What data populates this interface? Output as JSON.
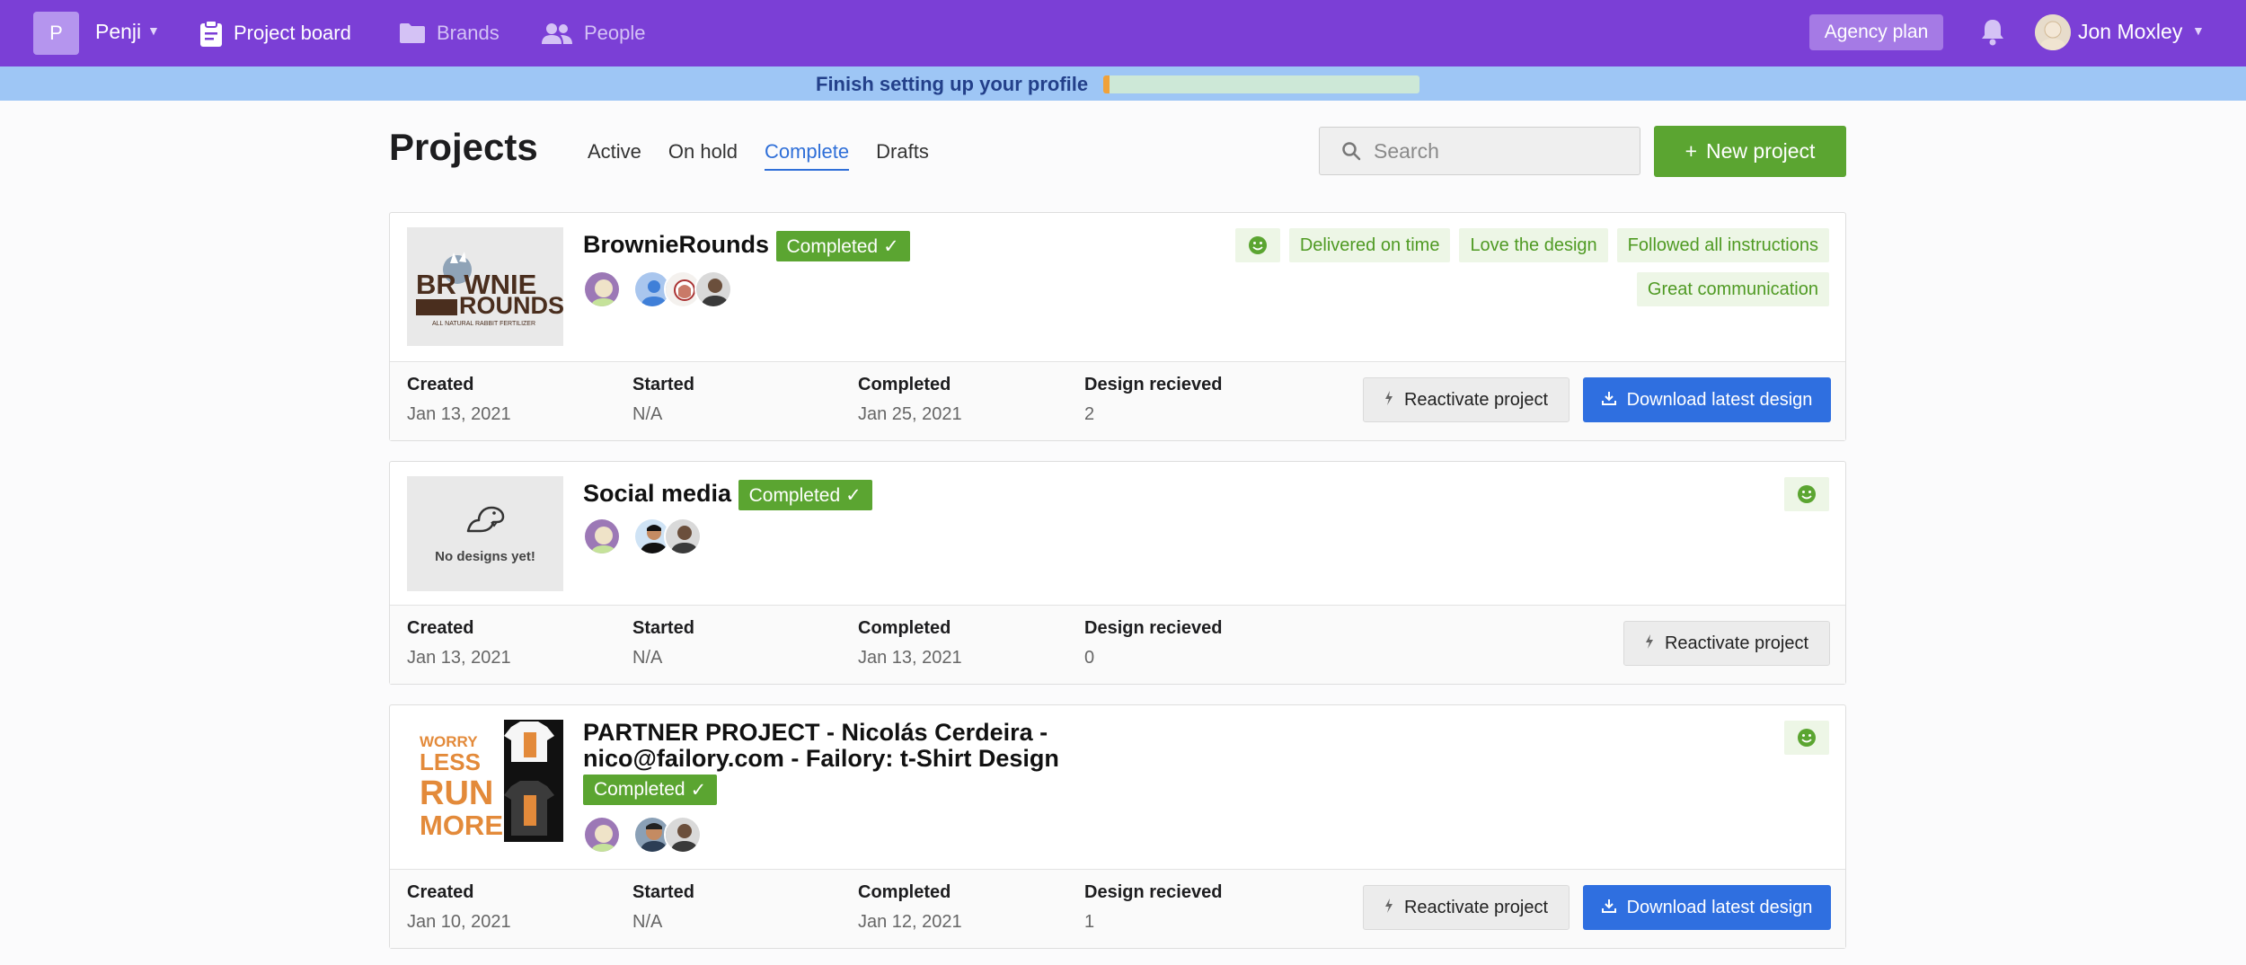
{
  "nav": {
    "workspace_initial": "P",
    "workspace_name": "Penji",
    "project_board": "Project board",
    "brands": "Brands",
    "people": "People",
    "plan": "Agency plan",
    "user_name": "Jon Moxley"
  },
  "banner": {
    "text": "Finish setting up your profile",
    "progress": 0.02
  },
  "page": {
    "title": "Projects",
    "tabs": [
      {
        "label": "Active"
      },
      {
        "label": "On hold"
      },
      {
        "label": "Complete"
      },
      {
        "label": "Drafts"
      }
    ],
    "active_tab": "Complete",
    "search_placeholder": "Search",
    "new_project": "New project"
  },
  "labels": {
    "created": "Created",
    "started": "Started",
    "completed": "Completed",
    "design_received": "Design recieved",
    "reactivate": "Reactivate project",
    "download": "Download latest design",
    "completed_badge": "Completed",
    "no_designs": "No designs yet!"
  },
  "projects": [
    {
      "title": "BrownieRounds",
      "logo_text_1": "BR   WNIE",
      "logo_text_2": "ROUNDS",
      "logo_text_3": "ALL NATURAL RABBIT FERTILIZER",
      "tags": [
        "Delivered on time",
        "Love the design",
        "Followed all instructions",
        "Great communication"
      ],
      "created": "Jan 13, 2021",
      "started": "N/A",
      "completed": "Jan 25, 2021",
      "designs": "2"
    },
    {
      "title": "Social media",
      "created": "Jan 13, 2021",
      "started": "N/A",
      "completed": "Jan 13, 2021",
      "designs": "0"
    },
    {
      "title_line_1": "PARTNER PROJECT - Nicolás Cerdeira -",
      "title_line_2": "nico@failory.com - Failory: t-Shirt Design",
      "shirt_text": [
        "WORRY",
        "LESS",
        "RUN",
        "MORE"
      ],
      "created": "Jan 10, 2021",
      "started": "N/A",
      "completed": "Jan 12, 2021",
      "designs": "1"
    }
  ],
  "colors": {
    "nav_bg": "#7b3fd6",
    "banner_bg": "#9ec6f5",
    "success_green": "#5ba531",
    "primary_blue": "#2f6fe0"
  }
}
